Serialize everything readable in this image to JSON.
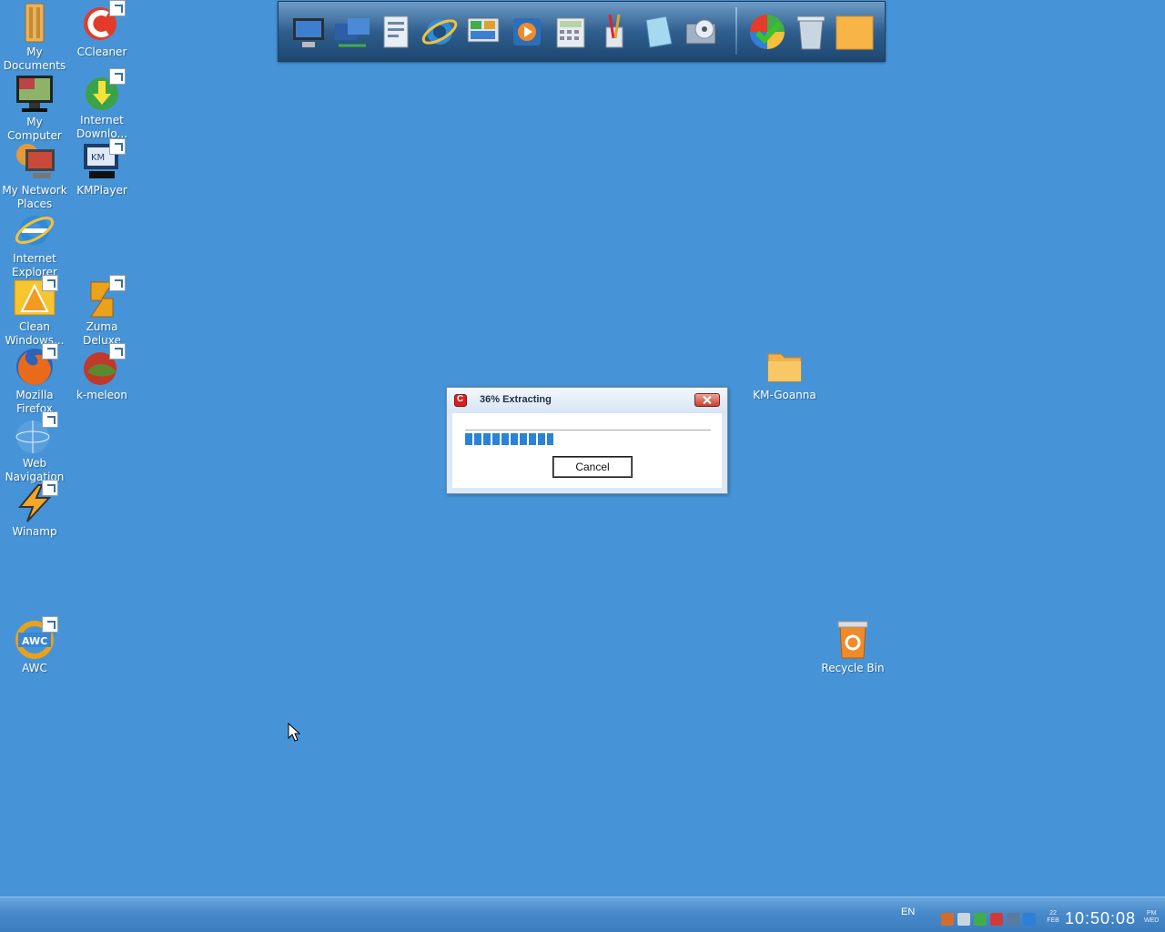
{
  "desktop": {
    "background": "#4694d7",
    "icons": [
      {
        "label": "My Documents",
        "icon": "my-documents-icon",
        "shortcut": false
      },
      {
        "label": "CCleaner",
        "icon": "ccleaner-icon",
        "shortcut": true
      },
      {
        "label": "My Computer",
        "icon": "my-computer-icon",
        "shortcut": false
      },
      {
        "label": "Internet Downlo...",
        "icon": "internet-download-manager-icon",
        "shortcut": true
      },
      {
        "label": "My Network Places",
        "icon": "my-network-places-icon",
        "shortcut": false
      },
      {
        "label": "KMPlayer",
        "icon": "kmplayer-icon",
        "shortcut": true
      },
      {
        "label": "Internet Explorer",
        "icon": "internet-explorer-icon",
        "shortcut": false
      },
      {
        "label": "Clean Windows...",
        "icon": "clean-windows-icon",
        "shortcut": true
      },
      {
        "label": "Zuma Deluxe",
        "icon": "zuma-deluxe-icon",
        "shortcut": true
      },
      {
        "label": "Mozilla Firefox",
        "icon": "firefox-icon",
        "shortcut": true
      },
      {
        "label": "k-meleon",
        "icon": "k-meleon-icon",
        "shortcut": true
      },
      {
        "label": "Web Navigation",
        "icon": "web-navigation-icon",
        "shortcut": true
      },
      {
        "label": "Winamp",
        "icon": "winamp-icon",
        "shortcut": true
      },
      {
        "label": "AWC",
        "icon": "awc-icon",
        "shortcut": true
      },
      {
        "label": "KM-Goanna",
        "icon": "folder-icon",
        "shortcut": false
      },
      {
        "label": "Recycle Bin",
        "icon": "recycle-bin-icon",
        "shortcut": false
      }
    ]
  },
  "dock": {
    "items": [
      "my-computer-icon",
      "network-icon",
      "documents-icon",
      "internet-explorer-icon",
      "control-panel-icon",
      "media-player-icon",
      "calculator-icon",
      "paint-icon",
      "notepad-icon",
      "cd-drive-icon",
      "windows-logo-icon",
      "trash-icon",
      "folder-icon"
    ]
  },
  "dialog": {
    "title": "36% Extracting",
    "progress": 0.36,
    "cancel_label": "Cancel"
  },
  "taskbar": {
    "language": "EN",
    "clock": {
      "day": "22",
      "month": "FEB",
      "time": "10:50:08",
      "ampm": "PM",
      "weekday": "WED"
    }
  }
}
